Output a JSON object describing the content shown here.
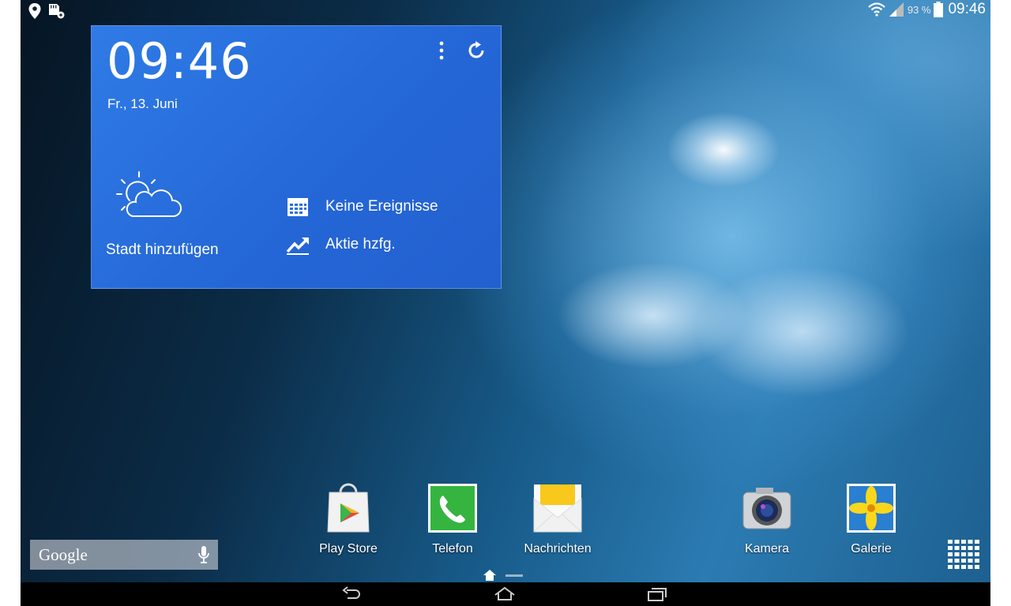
{
  "status_bar": {
    "left_icons": [
      "location-icon",
      "sd-card-settings-icon"
    ],
    "right_icons": [
      "wifi-icon",
      "signal-icon",
      "battery-icon"
    ],
    "battery_percent": "93 %",
    "time": "09:46"
  },
  "widget": {
    "time": "09:46",
    "date": "Fr., 13. Juni",
    "weather_action": "Stadt hinzufügen",
    "events_label": "Keine Ereignisse",
    "stocks_label": "Aktie hzfg.",
    "accent": "#2a6fe0"
  },
  "google_search": {
    "logo_text": "Google"
  },
  "dock": {
    "apps": [
      {
        "label": "Play Store",
        "icon": "play-store-icon"
      },
      {
        "label": "Telefon",
        "icon": "phone-icon"
      },
      {
        "label": "Nachrichten",
        "icon": "messages-icon"
      },
      {
        "label": "Kamera",
        "icon": "camera-icon"
      },
      {
        "label": "Galerie",
        "icon": "gallery-icon"
      }
    ]
  },
  "navigation": {
    "buttons": [
      "back-icon",
      "home-icon",
      "recent-apps-icon"
    ]
  }
}
